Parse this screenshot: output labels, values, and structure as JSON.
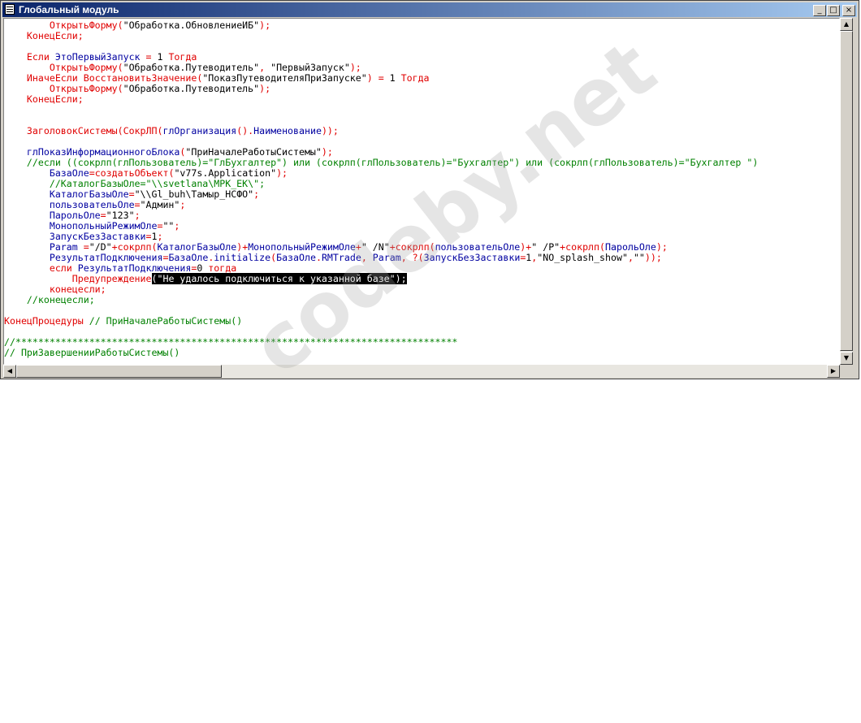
{
  "window": {
    "title": "Глобальный модуль",
    "controls": {
      "minimize": "_",
      "maximize": "□",
      "close": "×"
    }
  },
  "watermark": "codeby.net",
  "code": {
    "lines": [
      [
        [
          "        ",
          ""
        ],
        [
          "ОткрытьФорму",
          "kw"
        ],
        [
          "(",
          "op"
        ],
        [
          "\"Обработка.ОбновлениеИБ\"",
          "str"
        ],
        [
          ");",
          "op"
        ]
      ],
      [
        [
          "    ",
          ""
        ],
        [
          "КонецЕсли",
          "kw"
        ],
        [
          ";",
          "op"
        ]
      ],
      [
        [
          "",
          ""
        ]
      ],
      [
        [
          "    ",
          ""
        ],
        [
          "Если ",
          "kw"
        ],
        [
          "ЭтоПервыйЗапуск",
          "idn"
        ],
        [
          " = ",
          "op"
        ],
        [
          "1",
          "num"
        ],
        [
          " Тогда",
          "kw"
        ]
      ],
      [
        [
          "        ",
          ""
        ],
        [
          "ОткрытьФорму",
          "kw"
        ],
        [
          "(",
          "op"
        ],
        [
          "\"Обработка.Путеводитель\"",
          "str"
        ],
        [
          ", ",
          "op"
        ],
        [
          "\"ПервыйЗапуск\"",
          "str"
        ],
        [
          ");",
          "op"
        ]
      ],
      [
        [
          "    ",
          ""
        ],
        [
          "ИначеЕсли ",
          "kw"
        ],
        [
          "ВосстановитьЗначение",
          "kw"
        ],
        [
          "(",
          "op"
        ],
        [
          "\"ПоказПутеводителяПриЗапуске\"",
          "str"
        ],
        [
          ") = ",
          "op"
        ],
        [
          "1",
          "num"
        ],
        [
          " Тогда",
          "kw"
        ]
      ],
      [
        [
          "        ",
          ""
        ],
        [
          "ОткрытьФорму",
          "kw"
        ],
        [
          "(",
          "op"
        ],
        [
          "\"Обработка.Путеводитель\"",
          "str"
        ],
        [
          ");",
          "op"
        ]
      ],
      [
        [
          "    ",
          ""
        ],
        [
          "КонецЕсли",
          "kw"
        ],
        [
          ";",
          "op"
        ]
      ],
      [
        [
          "",
          ""
        ]
      ],
      [
        [
          "",
          ""
        ]
      ],
      [
        [
          "    ",
          ""
        ],
        [
          "ЗаголовокСистемы",
          "kw"
        ],
        [
          "(",
          "op"
        ],
        [
          "СокрЛП",
          "kw"
        ],
        [
          "(",
          "op"
        ],
        [
          "глОрганизация",
          "idn"
        ],
        [
          "().",
          "op"
        ],
        [
          "Наименование",
          "idn"
        ],
        [
          "));",
          "op"
        ]
      ],
      [
        [
          "",
          ""
        ]
      ],
      [
        [
          "    ",
          ""
        ],
        [
          "глПоказИнформационногоБлока",
          "idn"
        ],
        [
          "(",
          "op"
        ],
        [
          "\"ПриНачалеРаботыСистемы\"",
          "str"
        ],
        [
          ");",
          "op"
        ]
      ],
      [
        [
          "    ",
          ""
        ],
        [
          "//если ((сокрлп(глПользователь)=\"ГлБухгалтер\") или (сокрлп(глПользователь)=\"Бухгалтер\") или (сокрлп(глПользователь)=\"Бухгалтер \") ",
          "cm"
        ]
      ],
      [
        [
          "        ",
          ""
        ],
        [
          "БазаОле",
          "idn"
        ],
        [
          "=",
          "op"
        ],
        [
          "создатьОбъект",
          "kw"
        ],
        [
          "(",
          "op"
        ],
        [
          "\"v77s.Application\"",
          "str"
        ],
        [
          ");",
          "op"
        ]
      ],
      [
        [
          "        ",
          ""
        ],
        [
          "//КаталогБазыОле=\"\\\\svetlana\\MPK_EK\\\";",
          "cm"
        ]
      ],
      [
        [
          "        ",
          ""
        ],
        [
          "КаталогБазыОле",
          "idn"
        ],
        [
          "=",
          "op"
        ],
        [
          "\"\\\\Gl_buh\\Тамыр_НСФО\"",
          "str"
        ],
        [
          ";",
          "op"
        ]
      ],
      [
        [
          "        ",
          ""
        ],
        [
          "пользовательОле",
          "idn"
        ],
        [
          "=",
          "op"
        ],
        [
          "\"Админ\"",
          "str"
        ],
        [
          ";",
          "op"
        ]
      ],
      [
        [
          "        ",
          ""
        ],
        [
          "ПарольОле",
          "idn"
        ],
        [
          "=",
          "op"
        ],
        [
          "\"123\"",
          "str"
        ],
        [
          ";",
          "op"
        ]
      ],
      [
        [
          "        ",
          ""
        ],
        [
          "МонопольныйРежимОле",
          "idn"
        ],
        [
          "=",
          "op"
        ],
        [
          "\"\"",
          "str"
        ],
        [
          ";",
          "op"
        ]
      ],
      [
        [
          "        ",
          ""
        ],
        [
          "ЗапускБезЗаставки",
          "idn"
        ],
        [
          "=",
          "op"
        ],
        [
          "1",
          "num"
        ],
        [
          ";",
          "op"
        ]
      ],
      [
        [
          "        ",
          ""
        ],
        [
          "Param",
          "idn"
        ],
        [
          " =",
          "op"
        ],
        [
          "\"/D\"",
          "str"
        ],
        [
          "+",
          "op"
        ],
        [
          "сокрлп",
          "kw"
        ],
        [
          "(",
          "op"
        ],
        [
          "КаталогБазыОле",
          "idn"
        ],
        [
          ")+",
          "op"
        ],
        [
          "МонопольныйРежимОле",
          "idn"
        ],
        [
          "+",
          "op"
        ],
        [
          "\" /N\"",
          "str"
        ],
        [
          "+",
          "op"
        ],
        [
          "сокрлп",
          "kw"
        ],
        [
          "(",
          "op"
        ],
        [
          "пользовательОле",
          "idn"
        ],
        [
          ")+",
          "op"
        ],
        [
          "\" /P\"",
          "str"
        ],
        [
          "+",
          "op"
        ],
        [
          "сокрлп",
          "kw"
        ],
        [
          "(",
          "op"
        ],
        [
          "ПарольОле",
          "idn"
        ],
        [
          ");",
          "op"
        ]
      ],
      [
        [
          "        ",
          ""
        ],
        [
          "РезультатПодключения",
          "idn"
        ],
        [
          "=",
          "op"
        ],
        [
          "БазаОле",
          "idn"
        ],
        [
          ".",
          "op"
        ],
        [
          "initialize",
          "idn"
        ],
        [
          "(",
          "op"
        ],
        [
          "БазаОле",
          "idn"
        ],
        [
          ".",
          "op"
        ],
        [
          "RMTrade",
          "idn"
        ],
        [
          ", ",
          "op"
        ],
        [
          "Param",
          "idn"
        ],
        [
          ", ",
          "op"
        ],
        [
          "?(",
          "op"
        ],
        [
          "ЗапускБезЗаставки",
          "idn"
        ],
        [
          "=",
          "op"
        ],
        [
          "1",
          "num"
        ],
        [
          ",",
          "op"
        ],
        [
          "\"NO_splash_show\"",
          "str"
        ],
        [
          ",",
          "op"
        ],
        [
          "\"\"",
          "str"
        ],
        [
          "));",
          "op"
        ]
      ],
      [
        [
          "        ",
          ""
        ],
        [
          "если ",
          "kw"
        ],
        [
          "РезультатПодключения",
          "idn"
        ],
        [
          "=",
          "op"
        ],
        [
          "0",
          "num"
        ],
        [
          " тогда",
          "kw"
        ]
      ],
      [
        [
          "            ",
          ""
        ],
        [
          "Предупреждение",
          "kw"
        ],
        [
          "(\"Не удалось подключиться к указанной базе\");",
          "sel"
        ]
      ],
      [
        [
          "        ",
          ""
        ],
        [
          "конецесли",
          "kw"
        ],
        [
          ";",
          "op"
        ]
      ],
      [
        [
          "    ",
          ""
        ],
        [
          "//конецесли;",
          "cm"
        ]
      ],
      [
        [
          "",
          ""
        ]
      ],
      [
        [
          "",
          ""
        ],
        [
          "КонецПроцедуры",
          "kw"
        ],
        [
          " // ПриНачалеРаботыСистемы()",
          "cm"
        ]
      ],
      [
        [
          "",
          ""
        ]
      ],
      [
        [
          "",
          ""
        ],
        [
          "//******************************************************************************",
          "cm"
        ]
      ],
      [
        [
          "",
          ""
        ],
        [
          "// ПриЗавершенииРаботыСистемы()",
          "cm"
        ]
      ]
    ]
  }
}
